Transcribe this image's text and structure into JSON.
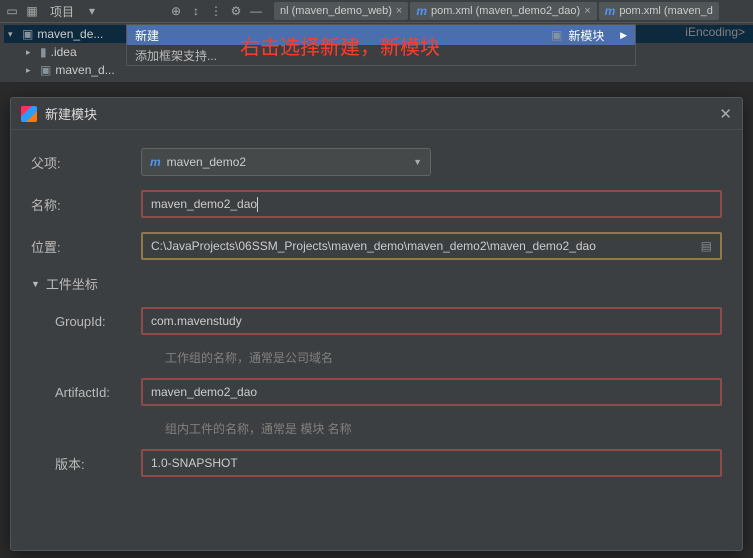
{
  "toolbar": {
    "project_label": "项目"
  },
  "tabs": [
    {
      "label": "nl (maven_demo_web)"
    },
    {
      "label": "pom.xml (maven_demo2_dao)"
    },
    {
      "label": "pom.xml (maven_d"
    }
  ],
  "tree": {
    "root": "maven_de...",
    "idea": ".idea",
    "sub": "maven_d..."
  },
  "context_menu": {
    "new": "新建",
    "add_framework": "添加框架支持...",
    "submenu_module": "新模块"
  },
  "code_hint": "iEncoding>",
  "annotation": "右击选择新建，新模块",
  "dialog": {
    "title": "新建模块",
    "parent_label": "父项:",
    "parent_value": "maven_demo2",
    "name_label": "名称:",
    "name_value": "maven_demo2_dao",
    "location_label": "位置:",
    "location_value": "C:\\JavaProjects\\06SSM_Projects\\maven_demo\\maven_demo2\\maven_demo2_dao",
    "coords_section": "工件坐标",
    "group_label": "GroupId:",
    "group_value": "com.mavenstudy",
    "group_help": "工作组的名称，通常是公司域名",
    "artifact_label": "ArtifactId:",
    "artifact_value": "maven_demo2_dao",
    "artifact_help": "组内工件的名称，通常是 模块 名称",
    "version_label": "版本:",
    "version_value": "1.0-SNAPSHOT"
  }
}
